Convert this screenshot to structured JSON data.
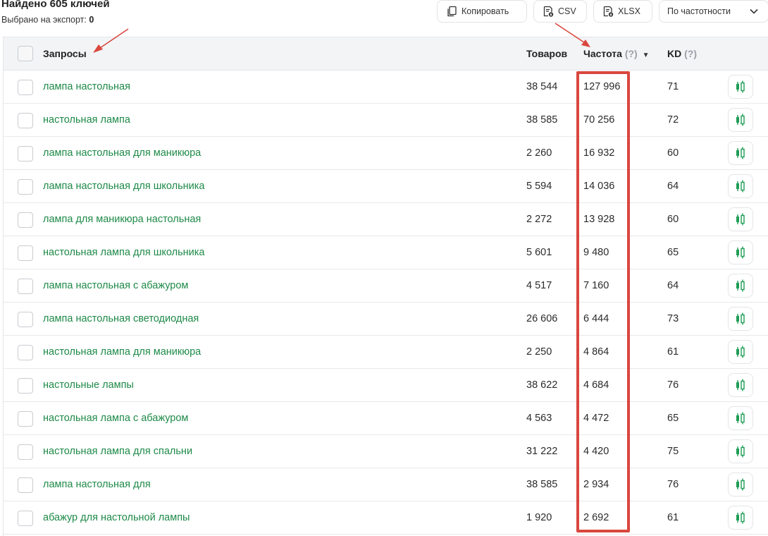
{
  "header": {
    "found_title": "Найдено 605 ключей",
    "selected_label": "Выбрано на экспорт:",
    "selected_count": "0"
  },
  "toolbar": {
    "copy_label": "Копировать",
    "csv_label": "CSV",
    "xlsx_label": "XLSX",
    "sort_value": "По частотности"
  },
  "table": {
    "columns": {
      "query": "Запросы",
      "goods": "Товаров",
      "freq": "Частота",
      "freq_hint": "(?)",
      "kd": "KD",
      "kd_hint": "(?)"
    },
    "rows": [
      {
        "query": "лампа настольная",
        "goods": "38 544",
        "freq": "127 996",
        "kd": "71"
      },
      {
        "query": "настольная лампа",
        "goods": "38 585",
        "freq": "70 256",
        "kd": "72"
      },
      {
        "query": "лампа настольная для маникюра",
        "goods": "2 260",
        "freq": "16 932",
        "kd": "60"
      },
      {
        "query": "лампа настольная для школьника",
        "goods": "5 594",
        "freq": "14 036",
        "kd": "64"
      },
      {
        "query": "лампа для маникюра настольная",
        "goods": "2 272",
        "freq": "13 928",
        "kd": "60"
      },
      {
        "query": "настольная лампа для школьника",
        "goods": "5 601",
        "freq": "9 480",
        "kd": "65"
      },
      {
        "query": "лампа настольная с абажуром",
        "goods": "4 517",
        "freq": "7 160",
        "kd": "64"
      },
      {
        "query": "лампа настольная светодиодная",
        "goods": "26 606",
        "freq": "6 444",
        "kd": "73"
      },
      {
        "query": "настольная лампа для маникюра",
        "goods": "2 250",
        "freq": "4 864",
        "kd": "61"
      },
      {
        "query": "настольные лампы",
        "goods": "38 622",
        "freq": "4 684",
        "kd": "76"
      },
      {
        "query": "настольная лампа с абажуром",
        "goods": "4 563",
        "freq": "4 472",
        "kd": "65"
      },
      {
        "query": "настольная лампа для спальни",
        "goods": "31 222",
        "freq": "4 420",
        "kd": "75"
      },
      {
        "query": "лампа настольная для",
        "goods": "38 585",
        "freq": "2 934",
        "kd": "76"
      },
      {
        "query": "абажур для настольной лампы",
        "goods": "1 920",
        "freq": "2 692",
        "kd": "61"
      }
    ]
  },
  "colors": {
    "link_green": "#1e8a48",
    "annotation_red": "#d9473f",
    "header_bg": "#f3f4f6"
  },
  "icons": {
    "copy": "copy-icon",
    "csv": "csv-file-icon",
    "xlsx": "xlsx-file-icon",
    "sort": "chevron-down-icon",
    "row_chart": "candlestick-chart-icon"
  }
}
